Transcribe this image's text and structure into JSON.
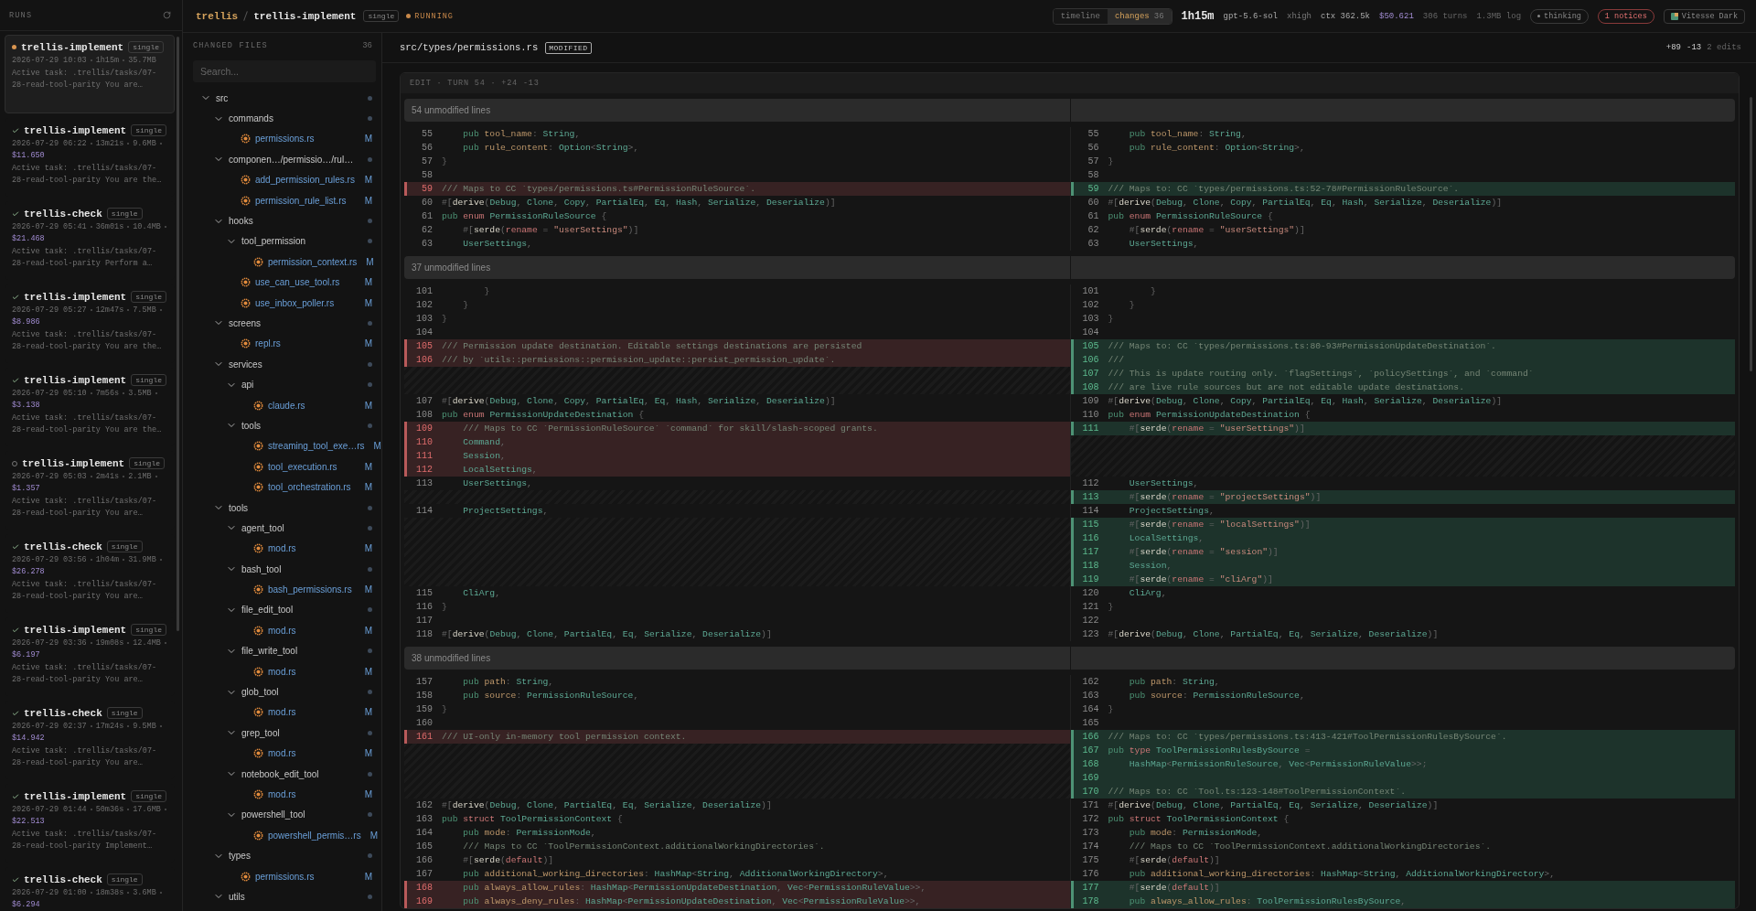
{
  "sidebar": {
    "title": "RUNS",
    "runs": [
      {
        "name": "trellis-implement",
        "badge": "single",
        "kind": "running",
        "selected": true,
        "meta": [
          "2026-07-29 10:03",
          "1h15m",
          "35.7MB"
        ],
        "task": "Active task: .trellis/tasks/07-28-read-tool-parity You are…"
      },
      {
        "name": "trellis-implement",
        "badge": "single",
        "kind": "done",
        "selected": false,
        "meta": [
          "2026-07-29 06:22",
          "13m21s",
          "9.6MB"
        ],
        "cost": "$11.650",
        "task": "Active task: .trellis/tasks/07-28-read-tool-parity You are the…"
      },
      {
        "name": "trellis-check",
        "badge": "single",
        "kind": "done",
        "selected": false,
        "meta": [
          "2026-07-29 05:41",
          "36m01s",
          "10.4MB"
        ],
        "cost": "$21.468",
        "task": "Active task: .trellis/tasks/07-28-read-tool-parity Perform a…"
      },
      {
        "name": "trellis-implement",
        "badge": "single",
        "kind": "done",
        "selected": false,
        "meta": [
          "2026-07-29 05:27",
          "12m47s",
          "7.5MB"
        ],
        "cost": "$8.986",
        "task": "Active task: .trellis/tasks/07-28-read-tool-parity You are the…"
      },
      {
        "name": "trellis-implement",
        "badge": "single",
        "kind": "done",
        "selected": false,
        "meta": [
          "2026-07-29 05:10",
          "7m56s",
          "3.5MB"
        ],
        "cost": "$3.138",
        "task": "Active task: .trellis/tasks/07-28-read-tool-parity You are the…"
      },
      {
        "name": "trellis-implement",
        "badge": "single",
        "kind": "stopped",
        "selected": false,
        "meta": [
          "2026-07-29 05:03",
          "2m41s",
          "2.1MB"
        ],
        "cost": "$1.357",
        "task": "Active task: .trellis/tasks/07-28-read-tool-parity You are…"
      },
      {
        "name": "trellis-check",
        "badge": "single",
        "kind": "done",
        "selected": false,
        "meta": [
          "2026-07-29 03:56",
          "1h04m",
          "31.9MB"
        ],
        "cost": "$26.278",
        "task": "Active task: .trellis/tasks/07-28-read-tool-parity You are…"
      },
      {
        "name": "trellis-implement",
        "badge": "single",
        "kind": "done",
        "selected": false,
        "meta": [
          "2026-07-29 03:36",
          "19m08s",
          "12.4MB"
        ],
        "cost": "$6.197",
        "task": "Active task: .trellis/tasks/07-28-read-tool-parity You are…"
      },
      {
        "name": "trellis-check",
        "badge": "single",
        "kind": "done",
        "selected": false,
        "meta": [
          "2026-07-29 02:37",
          "17m24s",
          "9.5MB"
        ],
        "cost": "$14.942",
        "task": "Active task: .trellis/tasks/07-28-read-tool-parity You are…"
      },
      {
        "name": "trellis-implement",
        "badge": "single",
        "kind": "done",
        "selected": false,
        "meta": [
          "2026-07-29 01:44",
          "50m36s",
          "17.6MB"
        ],
        "cost": "$22.513",
        "task": "Active task: .trellis/tasks/07-28-read-tool-parity Implement…"
      },
      {
        "name": "trellis-check",
        "badge": "single",
        "kind": "done",
        "selected": false,
        "meta": [
          "2026-07-29 01:00",
          "18m38s",
          "3.6MB"
        ],
        "cost": "$6.294"
      }
    ]
  },
  "breadcrumb": {
    "project": "trellis",
    "run": "trellis-implement",
    "badge": "single",
    "status": "RUNNING"
  },
  "toolbar": {
    "tabs": [
      {
        "label": "timeline",
        "selected": false
      },
      {
        "label": "changes",
        "count": "36",
        "selected": true
      }
    ],
    "duration": "1h15m",
    "model": "gpt-5.6-sol",
    "effort": "xhigh",
    "ctx": "ctx 362.5k",
    "cost": "$50.621",
    "turns": "306 turns",
    "log": "1.3MB log",
    "thinking": "thinking",
    "notices": "1 notices",
    "theme": "Vitesse Dark"
  },
  "files": {
    "title": "CHANGED FILES",
    "count": "36",
    "search": {
      "placeholder": "Search..."
    },
    "tree": [
      {
        "name": "src",
        "kind": "folder",
        "expanded": true,
        "children": [
          {
            "name": "commands",
            "kind": "folder",
            "expanded": true,
            "children": [
              {
                "name": "permissions.rs",
                "kind": "file",
                "status": "M"
              }
            ]
          },
          {
            "name": "componen…/permissio…/rul…",
            "kind": "folder",
            "expanded": true,
            "children": [
              {
                "name": "add_permission_rules.rs",
                "kind": "file",
                "status": "M"
              },
              {
                "name": "permission_rule_list.rs",
                "kind": "file",
                "status": "M"
              }
            ]
          },
          {
            "name": "hooks",
            "kind": "folder",
            "expanded": true,
            "children": [
              {
                "name": "tool_permission",
                "kind": "folder",
                "expanded": true,
                "children": [
                  {
                    "name": "permission_context.rs",
                    "kind": "file",
                    "status": "M"
                  }
                ]
              },
              {
                "name": "use_can_use_tool.rs",
                "kind": "file",
                "status": "M"
              },
              {
                "name": "use_inbox_poller.rs",
                "kind": "file",
                "status": "M"
              }
            ]
          },
          {
            "name": "screens",
            "kind": "folder",
            "expanded": true,
            "children": [
              {
                "name": "repl.rs",
                "kind": "file",
                "status": "M"
              }
            ]
          },
          {
            "name": "services",
            "kind": "folder",
            "expanded": true,
            "children": [
              {
                "name": "api",
                "kind": "folder",
                "expanded": true,
                "children": [
                  {
                    "name": "claude.rs",
                    "kind": "file",
                    "status": "M"
                  }
                ]
              },
              {
                "name": "tools",
                "kind": "folder",
                "expanded": true,
                "children": [
                  {
                    "name": "streaming_tool_exe…rs",
                    "kind": "file",
                    "status": "M"
                  },
                  {
                    "name": "tool_execution.rs",
                    "kind": "file",
                    "status": "M"
                  },
                  {
                    "name": "tool_orchestration.rs",
                    "kind": "file",
                    "status": "M"
                  }
                ]
              }
            ]
          },
          {
            "name": "tools",
            "kind": "folder",
            "expanded": true,
            "children": [
              {
                "name": "agent_tool",
                "kind": "folder",
                "expanded": true,
                "children": [
                  {
                    "name": "mod.rs",
                    "kind": "file",
                    "status": "M"
                  }
                ]
              },
              {
                "name": "bash_tool",
                "kind": "folder",
                "expanded": true,
                "children": [
                  {
                    "name": "bash_permissions.rs",
                    "kind": "file",
                    "status": "M"
                  }
                ]
              },
              {
                "name": "file_edit_tool",
                "kind": "folder",
                "expanded": true,
                "children": [
                  {
                    "name": "mod.rs",
                    "kind": "file",
                    "status": "M"
                  }
                ]
              },
              {
                "name": "file_write_tool",
                "kind": "folder",
                "expanded": true,
                "children": [
                  {
                    "name": "mod.rs",
                    "kind": "file",
                    "status": "M"
                  }
                ]
              },
              {
                "name": "glob_tool",
                "kind": "folder",
                "expanded": true,
                "children": [
                  {
                    "name": "mod.rs",
                    "kind": "file",
                    "status": "M"
                  }
                ]
              },
              {
                "name": "grep_tool",
                "kind": "folder",
                "expanded": true,
                "children": [
                  {
                    "name": "mod.rs",
                    "kind": "file",
                    "status": "M"
                  }
                ]
              },
              {
                "name": "notebook_edit_tool",
                "kind": "folder",
                "expanded": true,
                "children": [
                  {
                    "name": "mod.rs",
                    "kind": "file",
                    "status": "M"
                  }
                ]
              },
              {
                "name": "powershell_tool",
                "kind": "folder",
                "expanded": true,
                "children": [
                  {
                    "name": "powershell_permis…rs",
                    "kind": "file",
                    "status": "M"
                  }
                ]
              }
            ]
          },
          {
            "name": "types",
            "kind": "folder",
            "expanded": true,
            "children": [
              {
                "name": "permissions.rs",
                "kind": "file",
                "status": "M"
              }
            ]
          },
          {
            "name": "utils",
            "kind": "folder",
            "expanded": true
          }
        ]
      }
    ]
  },
  "file": {
    "path": "src/types/permissions.rs",
    "badge": "MODIFIED",
    "added": "+89",
    "removed": "-13",
    "edits": "2 edits"
  },
  "diff": {
    "header": "EDIT · TURN 54 · +24 -13",
    "blocks": [
      {
        "kind": "collapsed",
        "label": "54 unmodified lines"
      },
      {
        "kind": "context",
        "left": [
          {
            "n": "55",
            "code": "    pub tool_name: String,"
          },
          {
            "n": "56",
            "code": "    pub rule_content: Option<String>,"
          },
          {
            "n": "57",
            "code": "}"
          },
          {
            "n": "58"
          }
        ],
        "right": [
          {
            "n": "55",
            "code": "    pub tool_name: String,"
          },
          {
            "n": "56",
            "code": "    pub rule_content: Option<String>,"
          },
          {
            "n": "57",
            "code": "}"
          },
          {
            "n": "58"
          }
        ]
      },
      {
        "kind": "change",
        "left": [
          {
            "n": "59",
            "code": "/// Maps to CC `types/permissions.ts#PermissionRuleSource`."
          }
        ],
        "right": [
          {
            "n": "59",
            "code": "/// Maps to: CC `types/permissions.ts:52-78#PermissionRuleSource`."
          }
        ]
      },
      {
        "kind": "context",
        "left": [
          {
            "n": "60",
            "code": "#[derive(Debug, Clone, Copy, PartialEq, Eq, Hash, Serialize, Deserialize)]"
          },
          {
            "n": "61",
            "code": "pub enum PermissionRuleSource {"
          },
          {
            "n": "62",
            "code": "    #[serde(rename = \"userSettings\")]"
          },
          {
            "n": "63",
            "code": "    UserSettings,"
          }
        ],
        "right": [
          {
            "n": "60",
            "code": "#[derive(Debug, Clone, Copy, PartialEq, Eq, Hash, Serialize, Deserialize)]"
          },
          {
            "n": "61",
            "code": "pub enum PermissionRuleSource {"
          },
          {
            "n": "62",
            "code": "    #[serde(rename = \"userSettings\")]"
          },
          {
            "n": "63",
            "code": "    UserSettings,"
          }
        ]
      },
      {
        "kind": "collapsed",
        "label": "37 unmodified lines"
      },
      {
        "kind": "context",
        "left": [
          {
            "n": "101",
            "code": "        }"
          },
          {
            "n": "102",
            "code": "    }"
          },
          {
            "n": "103",
            "code": "}"
          },
          {
            "n": "104"
          }
        ],
        "right": [
          {
            "n": "101",
            "code": "        }"
          },
          {
            "n": "102",
            "code": "    }"
          },
          {
            "n": "103",
            "code": "}"
          },
          {
            "n": "104"
          }
        ]
      },
      {
        "kind": "change",
        "left": [
          {
            "n": "105",
            "code": "/// Permission update destination. Editable settings destinations are persisted"
          },
          {
            "n": "106",
            "code": "/// by `utils::permissions::permission_update::persist_permission_update`."
          }
        ],
        "right": [
          {
            "n": "105",
            "code": "/// Maps to: CC `types/permissions.ts:80-93#PermissionUpdateDestination`."
          },
          {
            "n": "106",
            "code": "///"
          },
          {
            "n": "107",
            "code": "/// This is update routing only. `flagSettings`, `policySettings`, and `command`"
          },
          {
            "n": "108",
            "code": "/// are live rule sources but are not editable update destinations."
          }
        ]
      },
      {
        "kind": "context",
        "left": [
          {
            "n": "107",
            "code": "#[derive(Debug, Clone, Copy, PartialEq, Eq, Hash, Serialize, Deserialize)]"
          },
          {
            "n": "108",
            "code": "pub enum PermissionUpdateDestination {"
          }
        ],
        "right": [
          {
            "n": "109",
            "code": "#[derive(Debug, Clone, Copy, PartialEq, Eq, Hash, Serialize, Deserialize)]"
          },
          {
            "n": "110",
            "code": "pub enum PermissionUpdateDestination {"
          }
        ]
      },
      {
        "kind": "change",
        "left": [
          {
            "n": "109",
            "code": "    /// Maps to CC `PermissionRuleSource` `command` for skill/slash-scoped grants."
          },
          {
            "n": "110",
            "code": "    Command,"
          },
          {
            "n": "111",
            "code": "    Session,"
          },
          {
            "n": "112",
            "code": "    LocalSettings,"
          }
        ],
        "right": [
          {
            "n": "111",
            "code": "    #[serde(rename = \"userSettings\")]"
          }
        ]
      },
      {
        "kind": "context",
        "left": [
          {
            "n": "113",
            "code": "    UserSettings,"
          }
        ],
        "right": [
          {
            "n": "112",
            "code": "    UserSettings,"
          }
        ]
      },
      {
        "kind": "change",
        "right": [
          {
            "n": "113",
            "code": "    #[serde(rename = \"projectSettings\")]"
          }
        ]
      },
      {
        "kind": "context",
        "left": [
          {
            "n": "114",
            "code": "    ProjectSettings,"
          }
        ],
        "right": [
          {
            "n": "114",
            "code": "    ProjectSettings,"
          }
        ]
      },
      {
        "kind": "change",
        "right": [
          {
            "n": "115",
            "code": "    #[serde(rename = \"localSettings\")]"
          },
          {
            "n": "116",
            "code": "    LocalSettings,"
          },
          {
            "n": "117",
            "code": "    #[serde(rename = \"session\")]"
          },
          {
            "n": "118",
            "code": "    Session,"
          },
          {
            "n": "119",
            "code": "    #[serde(rename = \"cliArg\")]"
          }
        ]
      },
      {
        "kind": "context",
        "left": [
          {
            "n": "115",
            "code": "    CliArg,"
          },
          {
            "n": "116",
            "code": "}"
          },
          {
            "n": "117"
          },
          {
            "n": "118",
            "code": "#[derive(Debug, Clone, PartialEq, Eq, Serialize, Deserialize)]"
          }
        ],
        "right": [
          {
            "n": "120",
            "code": "    CliArg,"
          },
          {
            "n": "121",
            "code": "}"
          },
          {
            "n": "122"
          },
          {
            "n": "123",
            "code": "#[derive(Debug, Clone, PartialEq, Eq, Serialize, Deserialize)]"
          }
        ]
      },
      {
        "kind": "collapsed",
        "label": "38 unmodified lines"
      },
      {
        "kind": "context",
        "left": [
          {
            "n": "157",
            "code": "    pub path: String,"
          },
          {
            "n": "158",
            "code": "    pub source: PermissionRuleSource,"
          },
          {
            "n": "159",
            "code": "}"
          },
          {
            "n": "160"
          }
        ],
        "right": [
          {
            "n": "162",
            "code": "    pub path: String,"
          },
          {
            "n": "163",
            "code": "    pub source: PermissionRuleSource,"
          },
          {
            "n": "164",
            "code": "}"
          },
          {
            "n": "165"
          }
        ]
      },
      {
        "kind": "change",
        "left": [
          {
            "n": "161",
            "code": "/// UI-only in-memory tool permission context."
          }
        ],
        "right": [
          {
            "n": "166",
            "code": "/// Maps to: CC `types/permissions.ts:413-421#ToolPermissionRulesBySource`."
          },
          {
            "n": "167",
            "code": "pub type ToolPermissionRulesBySource ="
          },
          {
            "n": "168",
            "code": "    HashMap<PermissionRuleSource, Vec<PermissionRuleValue>>;"
          },
          {
            "n": "169"
          },
          {
            "n": "170",
            "code": "/// Maps to: CC `Tool.ts:123-148#ToolPermissionContext`."
          }
        ]
      },
      {
        "kind": "context",
        "left": [
          {
            "n": "162",
            "code": "#[derive(Debug, Clone, PartialEq, Eq, Serialize, Deserialize)]"
          },
          {
            "n": "163",
            "code": "pub struct ToolPermissionContext {"
          },
          {
            "n": "164",
            "code": "    pub mode: PermissionMode,"
          },
          {
            "n": "165",
            "code": "    /// Maps to CC `ToolPermissionContext.additionalWorkingDirectories`."
          },
          {
            "n": "166",
            "code": "    #[serde(default)]"
          },
          {
            "n": "167",
            "code": "    pub additional_working_directories: HashMap<String, AdditionalWorkingDirectory>,"
          }
        ],
        "right": [
          {
            "n": "171",
            "code": "#[derive(Debug, Clone, PartialEq, Eq, Serialize, Deserialize)]"
          },
          {
            "n": "172",
            "code": "pub struct ToolPermissionContext {"
          },
          {
            "n": "173",
            "code": "    pub mode: PermissionMode,"
          },
          {
            "n": "174",
            "code": "    /// Maps to CC `ToolPermissionContext.additionalWorkingDirectories`."
          },
          {
            "n": "175",
            "code": "    #[serde(default)]"
          },
          {
            "n": "176",
            "code": "    pub additional_working_directories: HashMap<String, AdditionalWorkingDirectory>,"
          }
        ]
      },
      {
        "kind": "change",
        "left": [
          {
            "n": "168",
            "code": "    pub always_allow_rules: HashMap<PermissionUpdateDestination, Vec<PermissionRuleValue>>,"
          },
          {
            "n": "169",
            "code": "    pub always_deny_rules: HashMap<PermissionUpdateDestination, Vec<PermissionRuleValue>>,"
          }
        ],
        "right": [
          {
            "n": "177",
            "code": "    #[serde(default)]"
          },
          {
            "n": "178",
            "code": "    pub always_allow_rules: ToolPermissionRulesBySource,"
          }
        ]
      }
    ]
  }
}
